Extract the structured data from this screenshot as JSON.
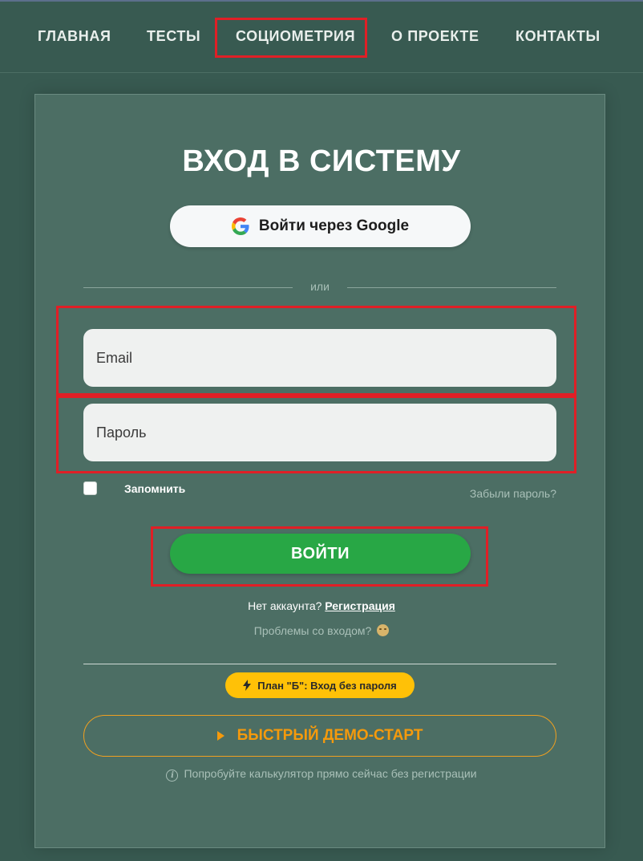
{
  "nav": {
    "items": [
      {
        "label": "ГЛАВНАЯ"
      },
      {
        "label": "ТЕСТЫ"
      },
      {
        "label": "СОЦИОМЕТРИЯ"
      },
      {
        "label": "О ПРОЕКТЕ"
      },
      {
        "label": "КОНТАКТЫ"
      }
    ]
  },
  "login": {
    "title": "ВХОД В СИСТЕМУ",
    "google_label": "Войти через Google",
    "or_label": "или",
    "email_placeholder": "Email",
    "password_placeholder": "Пароль",
    "remember_label": "Запомнить",
    "forgot_label": "Забыли пароль?",
    "submit_label": "ВОЙТИ",
    "no_account_text": "Нет аккаунта?",
    "register_label": "Регистрация",
    "problems_text": "Проблемы со входом?",
    "planb_label": "План \"Б\": Вход без пароля",
    "demo_label": "БЫСТРЫЙ ДЕМО-СТАРТ",
    "hint_text": "Попробуйте калькулятор прямо сейчас без регистрации"
  },
  "colors": {
    "background": "#385a51",
    "card": "#4c6e64",
    "primary_green": "#28a745",
    "warning_yellow": "#ffc107",
    "demo_orange": "#f59a0c",
    "highlight_red": "#e01f26"
  },
  "icons": {
    "google": "google-g-icon",
    "bolt": "lightning-bolt-icon",
    "play": "play-triangle-icon",
    "info": "info-circle-icon",
    "emoji": "downcast-face-emoji"
  }
}
